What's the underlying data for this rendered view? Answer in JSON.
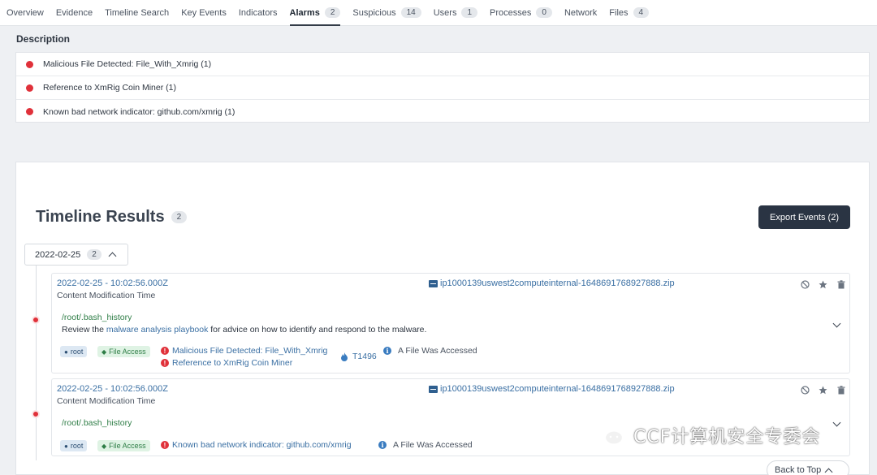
{
  "tabs": [
    {
      "label": "Overview",
      "count": null
    },
    {
      "label": "Evidence",
      "count": null
    },
    {
      "label": "Timeline Search",
      "count": null
    },
    {
      "label": "Key Events",
      "count": null
    },
    {
      "label": "Indicators",
      "count": null
    },
    {
      "label": "Alarms",
      "count": "2"
    },
    {
      "label": "Suspicious",
      "count": "14"
    },
    {
      "label": "Users",
      "count": "1"
    },
    {
      "label": "Processes",
      "count": "0"
    },
    {
      "label": "Network",
      "count": null
    },
    {
      "label": "Files",
      "count": "4"
    }
  ],
  "description": {
    "title": "Description",
    "items": [
      "Malicious File Detected: File_With_Xmrig (1)",
      "Reference to XmRig Coin Miner (1)",
      "Known bad network indicator: github.com/xmrig (1)"
    ]
  },
  "timeline": {
    "title": "Timeline Results",
    "count": "2",
    "export_label": "Export Events (2)",
    "date_group": {
      "label": "2022-02-25",
      "count": "2"
    },
    "events": [
      {
        "time": "2022-02-25 - 10:02:56.000Z",
        "subtitle": "Content Modification Time",
        "file": "ip1000139uswest2computeinternal-1648691768927888.zip",
        "path": "/root/.bash_history",
        "desc_pre": "Review the ",
        "desc_link": "malware analysis playbook",
        "desc_post": " for advice on how to identify and respond to the malware.",
        "user_tag": "root",
        "access_tag": "File Access",
        "alarms": [
          "Malicious File Detected: File_With_Xmrig",
          "Reference to XmRig Coin Miner"
        ],
        "mitre": "T1496",
        "info": "A File Was Accessed"
      },
      {
        "time": "2022-02-25 - 10:02:56.000Z",
        "subtitle": "Content Modification Time",
        "file": "ip1000139uswest2computeinternal-1648691768927888.zip",
        "path": "/root/.bash_history",
        "user_tag": "root",
        "access_tag": "File Access",
        "alarms": [
          "Known bad network indicator: github.com/xmrig"
        ],
        "info": "A File Was Accessed"
      }
    ],
    "back_to_top": "Back to Top"
  },
  "watermark": {
    "text": "CCF计算机安全专委会"
  },
  "colors": {
    "alert_red": "#e0313a",
    "link_blue": "#3a6fa3",
    "path_green": "#2e7d46",
    "dark_button": "#2a3443"
  }
}
